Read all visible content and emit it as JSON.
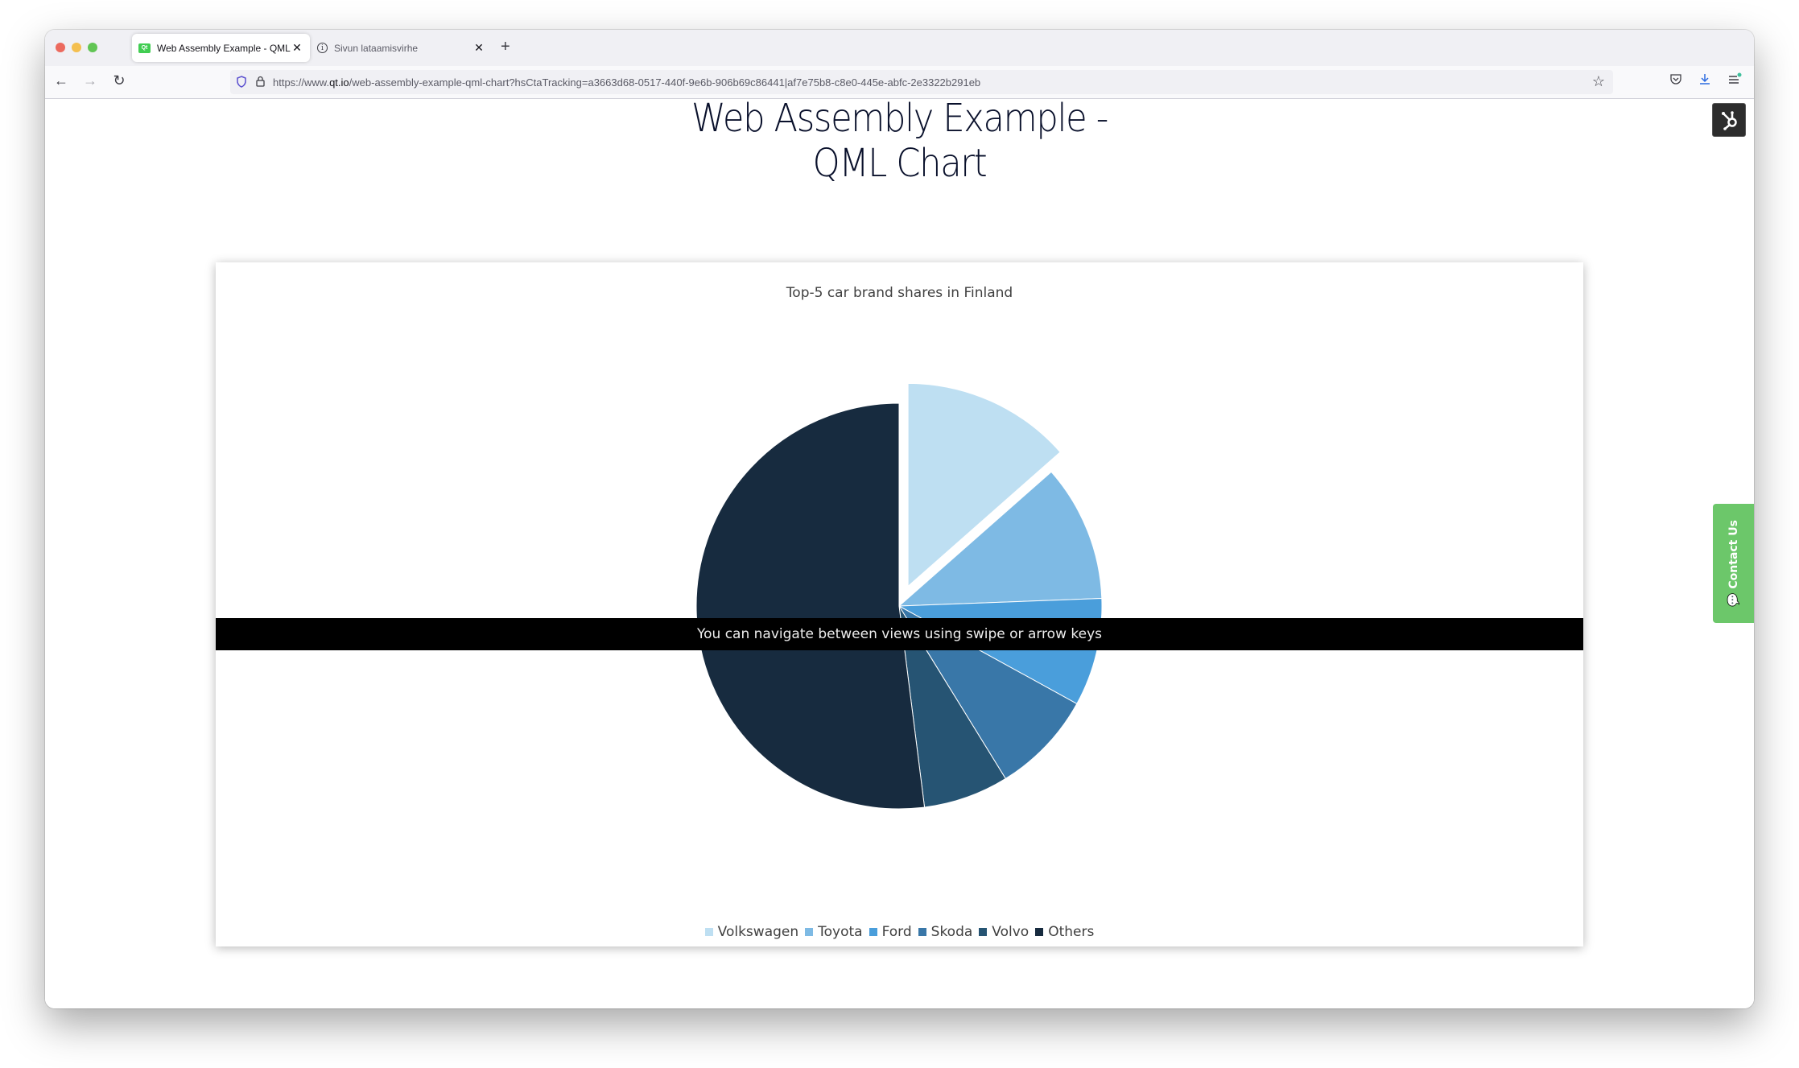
{
  "browser": {
    "tabs": [
      {
        "title": "Web Assembly Example - QML Chart",
        "favicon": "qt-logo-icon",
        "active": true
      },
      {
        "title": "Sivun lataamisvirhe",
        "favicon": "info-icon",
        "active": false
      }
    ],
    "new_tab_label": "+",
    "url_scheme": "https://www.",
    "url_host": "qt.io",
    "url_path": "/web-assembly-example-qml-chart?hsCtaTracking=a3663d68-0517-440f-9e6b-906b69c86441|af7e75b8-c8e0-445e-abfc-2e3322b291eb",
    "icons": {
      "back": "←",
      "forward": "→",
      "reload": "↻",
      "bookmark": "☆",
      "pocket": "pocket-icon",
      "download": "↓",
      "menu": "≡"
    }
  },
  "page": {
    "title": "Web Assembly Example - QML Chart",
    "contact_label": "Contact Us",
    "banner_text": "You can navigate between views using swipe or arrow keys"
  },
  "chart_data": {
    "type": "pie",
    "title": "Top-5 car brand shares in Finland",
    "categories": [
      "Volkswagen",
      "Toyota",
      "Ford",
      "Skoda",
      "Volvo",
      "Others"
    ],
    "values": [
      13.5,
      10.9,
      8.6,
      8.2,
      6.8,
      52.0
    ],
    "unit": "%",
    "colors": [
      "#bedff2",
      "#7ebae4",
      "#4a9edb",
      "#3977a8",
      "#265473",
      "#172b3f"
    ],
    "exploded": [
      "Volkswagen"
    ],
    "start_angle": "12 o'clock, clockwise",
    "legend_position": "bottom"
  }
}
